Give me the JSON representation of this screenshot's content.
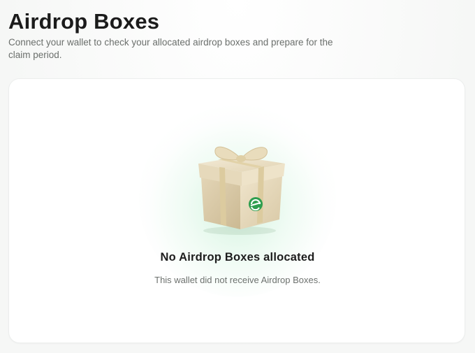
{
  "header": {
    "title": "Airdrop Boxes",
    "subtitle": "Connect your wallet to check your allocated airdrop boxes and prepare for the claim period."
  },
  "empty_state": {
    "illustration": "gift-box-icon",
    "title": "No Airdrop Boxes allocated",
    "description": "This wallet did not receive Airdrop Boxes."
  },
  "colors": {
    "accent_green": "#2e9e4f",
    "gift_beige": "#e8dcc0"
  }
}
